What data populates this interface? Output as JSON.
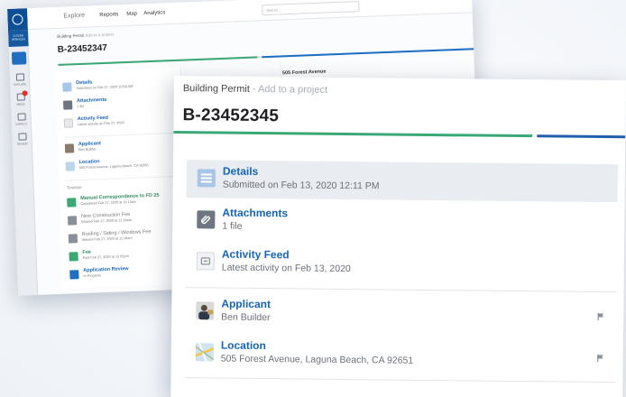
{
  "back_window": {
    "brand_text": "CITIZEN SERVICES",
    "topbar": {
      "explore": "Explore",
      "reports": "Reports",
      "map": "Map",
      "analytics": "Analytics",
      "search_placeholder": "Search..."
    },
    "sidebar": {
      "items": [
        "EXPLORE",
        "INBOX",
        "INSPECT",
        "REVIEW"
      ]
    },
    "breadcrumb": {
      "root": "Building Permit",
      "action": "Add to a project"
    },
    "title": "B-23452347",
    "rows": [
      {
        "label": "Details",
        "sub": "Submitted on Feb 27, 2020 10:58 AM"
      },
      {
        "label": "Attachments",
        "sub": "1 file"
      },
      {
        "label": "Activity Feed",
        "sub": "Latest activity on Feb 27, 2020"
      },
      {
        "label": "Applicant",
        "sub": "Ben Builder"
      },
      {
        "label": "Location",
        "sub": "505 Forest Avenue, Laguna Beach, CA 92651"
      }
    ],
    "timeline_label": "Timeline",
    "timeline": [
      {
        "label": "Manual Correspondence to FD 25",
        "sub": "Completed Feb 27, 2020 at 11:13am"
      },
      {
        "label": "New Construction Fee",
        "sub": "Waived Feb 27, 2020 at 11:18am"
      },
      {
        "label": "Roofing / Siding / Windows Fee",
        "sub": "Waived Feb 27, 2020 at 11:18am"
      },
      {
        "label": "Fee",
        "sub": "Paid Feb 27, 2020 at 12:02pm"
      },
      {
        "label": "Application Review",
        "sub": "In Progress"
      }
    ],
    "right_title": "505 Forest Avenue"
  },
  "front_card": {
    "breadcrumb": {
      "root": "Building Permit",
      "separator": " - ",
      "action": "Add to a project"
    },
    "title": "B-23452345",
    "items": [
      {
        "label": "Details",
        "sub": "Submitted on Feb 13, 2020 12:11 PM",
        "icon": "document-icon"
      },
      {
        "label": "Attachments",
        "sub": "1 file",
        "icon": "paperclip-icon"
      },
      {
        "label": "Activity Feed",
        "sub": "Latest activity on Feb 13, 2020",
        "icon": "activity-feed-icon"
      },
      {
        "label": "Applicant",
        "sub": "Ben Builder",
        "icon": "applicant-photo-icon"
      },
      {
        "label": "Location",
        "sub": "505 Forest Avenue, Laguna Beach, CA 92651",
        "icon": "map-icon"
      }
    ]
  },
  "colors": {
    "brand_blue": "#0e4e94",
    "link_blue": "#1665b8",
    "progress_green": "#3aa876",
    "progress_blue": "#1f5fae",
    "active_row": "#e9ecf0"
  }
}
